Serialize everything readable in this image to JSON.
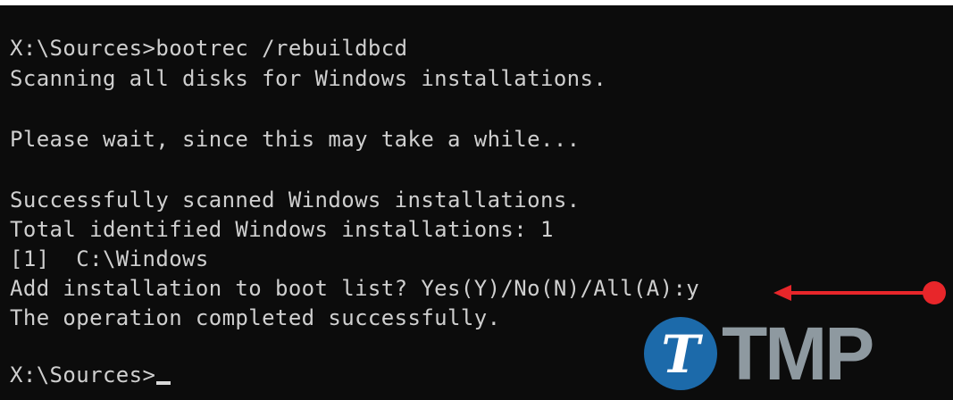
{
  "console": {
    "lines": [
      "X:\\Sources>bootrec /rebuildbcd",
      "Scanning all disks for Windows installations.",
      "",
      "Please wait, since this may take a while...",
      "",
      "Successfully scanned Windows installations.",
      "Total identified Windows installations: 1",
      "[1]  C:\\Windows",
      "Add installation to boot list? Yes(Y)/No(N)/All(A):y",
      "The operation completed successfully.",
      "",
      "X:\\Sources>"
    ]
  },
  "annotation": {
    "arrow_color": "#e8262a"
  },
  "watermark": {
    "letter": "T",
    "text": "TMP",
    "circle_color": "#1e73b8"
  }
}
